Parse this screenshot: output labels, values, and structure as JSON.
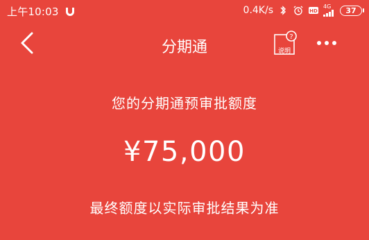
{
  "status_bar": {
    "time": "上午10:03",
    "net_speed": "0.4K/s",
    "hd": "HD",
    "network": "4G",
    "battery": "37"
  },
  "nav": {
    "title": "分期通",
    "help_label": "说明"
  },
  "main": {
    "limit_title": "您的分期通预审批额度",
    "limit_amount": "¥75,000",
    "limit_note": "最终额度以实际审批结果为准"
  }
}
